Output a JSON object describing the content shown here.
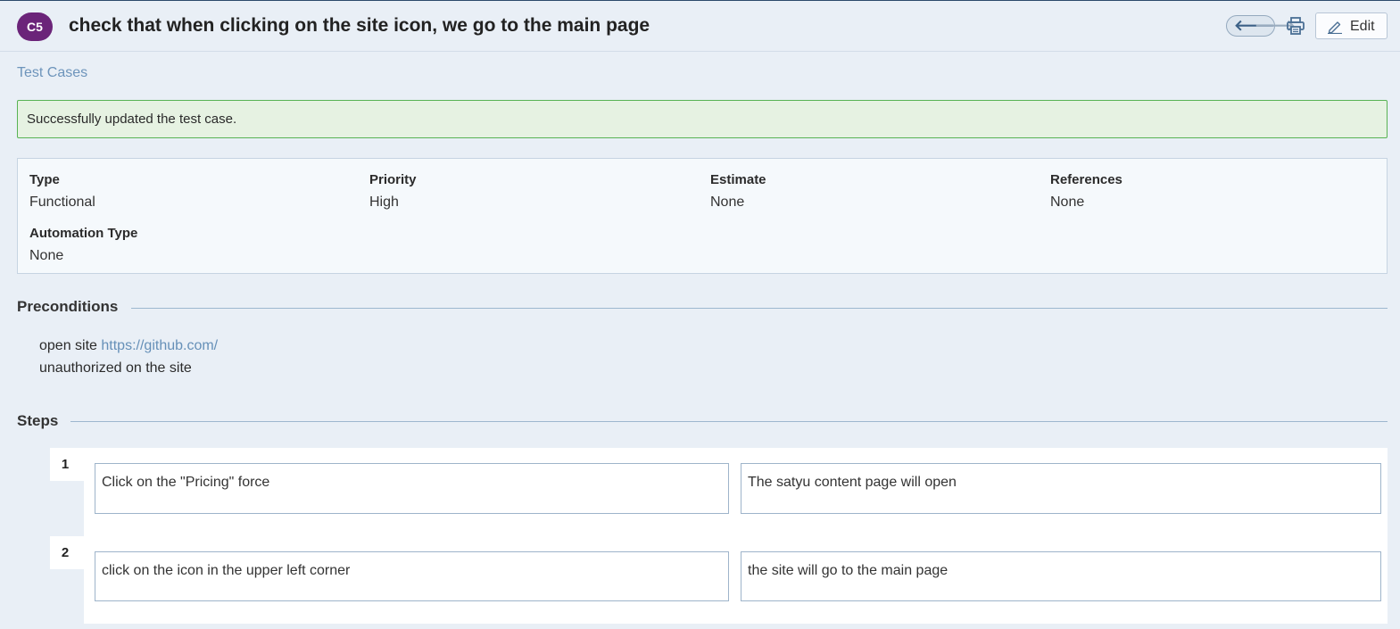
{
  "header": {
    "case_id": "C5",
    "title": "check that when clicking on the site icon, we go to the main page",
    "prev_arrow": "🡐",
    "next_arrow": "🡒",
    "edit_label": "Edit"
  },
  "breadcrumb": "Test Cases",
  "alert": "Successfully updated the test case.",
  "properties": [
    {
      "label": "Type",
      "value": "Functional"
    },
    {
      "label": "Priority",
      "value": "High"
    },
    {
      "label": "Estimate",
      "value": "None"
    },
    {
      "label": "References",
      "value": "None"
    },
    {
      "label": "Automation Type",
      "value": "None"
    }
  ],
  "preconditions": {
    "title": "Preconditions",
    "line1_prefix": "open site",
    "line1_link": "https://github.com/",
    "line2": "unauthorized on the site"
  },
  "steps": {
    "title": "Steps",
    "items": [
      {
        "number": "1",
        "action": "Click on the \"Pricing\" force",
        "expected": "The satyu content page will open"
      },
      {
        "number": "2",
        "action": "click on the icon in the upper left corner",
        "expected": "the site will go to the main page"
      }
    ]
  },
  "colors": {
    "badge": "#6b2479",
    "link": "#6690b8",
    "success_bg": "#e6f2e2",
    "success_border": "#58b354"
  },
  "icons": [
    "arrow-left-icon",
    "arrow-right-icon",
    "printer-icon",
    "pencil-icon"
  ]
}
